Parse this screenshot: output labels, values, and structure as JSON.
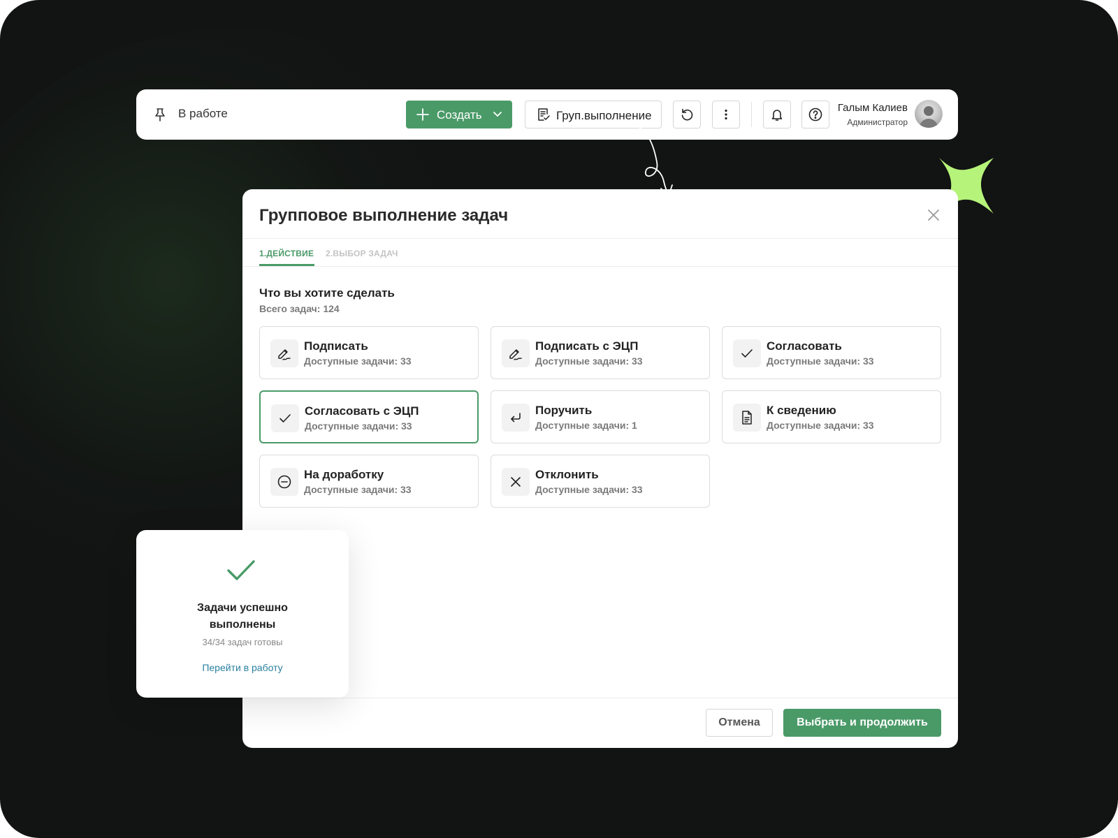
{
  "topbar": {
    "status_label": "В работе",
    "create_label": "Создать",
    "group_exec_label": "Груп.выполнение",
    "user_name": "Галым Калиев",
    "user_role": "Администратор"
  },
  "modal": {
    "title": "Групповое выполнение задач",
    "tabs": [
      {
        "label": "1.ДЕЙСТВИЕ",
        "active": true
      },
      {
        "label": "2.ВЫБОР ЗАДАЧ",
        "active": false
      }
    ],
    "question": "Что вы хотите сделать",
    "total": "Всего задач: 124",
    "actions": [
      {
        "title": "Подписать",
        "subtitle": "Доступные задачи: 33",
        "icon": "signature-icon"
      },
      {
        "title": "Подписать с ЭЦП",
        "subtitle": "Доступные задачи: 33",
        "icon": "signature-icon"
      },
      {
        "title": "Согласовать",
        "subtitle": "Доступные задачи: 33",
        "icon": "check-icon"
      },
      {
        "title": "Согласовать с ЭЦП",
        "subtitle": "Доступные задачи: 33",
        "icon": "check-icon",
        "selected": true
      },
      {
        "title": "Поручить",
        "subtitle": "Доступные задачи: 1",
        "icon": "return-arrow-icon"
      },
      {
        "title": "К сведению",
        "subtitle": "Доступные задачи: 33",
        "icon": "document-icon"
      },
      {
        "title": "На доработку",
        "subtitle": "Доступные задачи: 33",
        "icon": "minus-circle-icon"
      },
      {
        "title": "Отклонить",
        "subtitle": "Доступные задачи: 33",
        "icon": "close-icon"
      }
    ],
    "cancel_label": "Отмена",
    "continue_label": "Выбрать и продолжить"
  },
  "toast": {
    "title": "Задачи успешно выполнены",
    "subtitle": "34/34 задач готовы",
    "link": "Перейти в работу"
  },
  "colors": {
    "accent": "#4a9a68",
    "background": "#121313",
    "star": "#b6f37a",
    "link": "#2a7fa0"
  }
}
